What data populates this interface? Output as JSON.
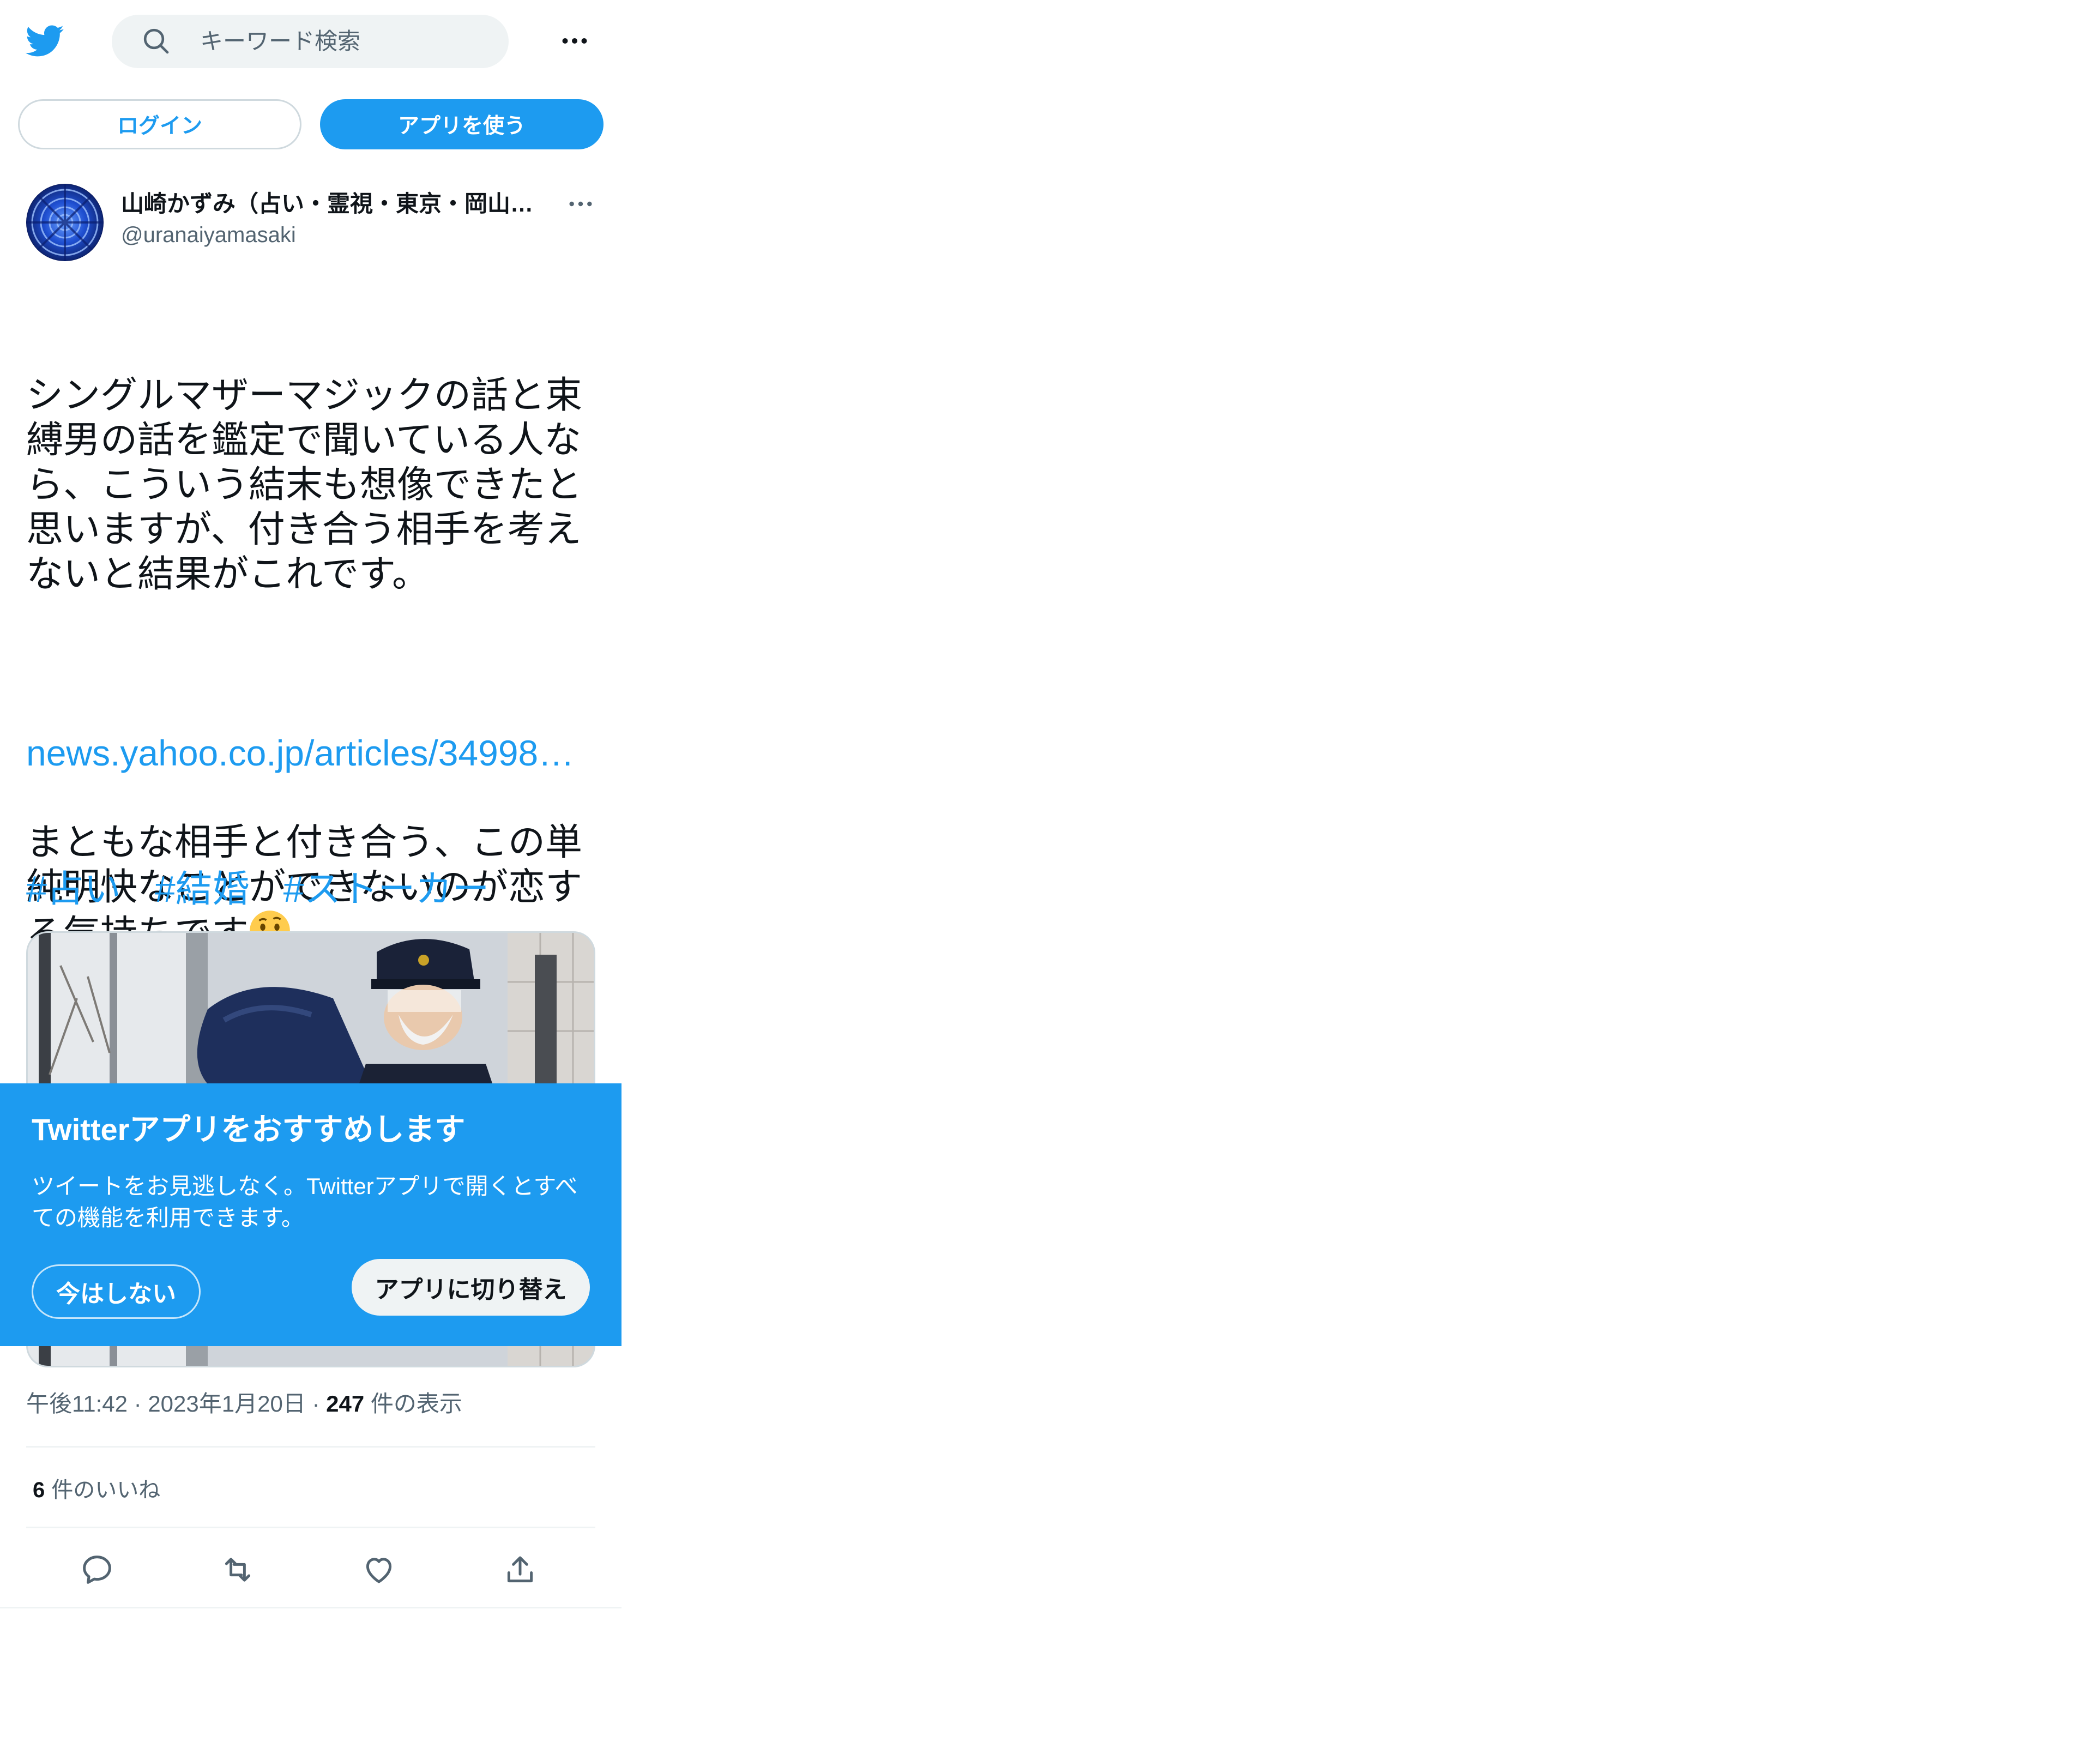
{
  "header": {
    "search_placeholder": "キーワード検索"
  },
  "auth": {
    "login_label": "ログイン",
    "use_app_label": "アプリを使う"
  },
  "tweet": {
    "author_name": "山崎かずみ（占い・霊視・東京・岡山・大阪）",
    "author_handle": "@uranaiyamasaki",
    "text_p1": "シングルマザーマジックの話と束縛男の話を鑑定で聞いている人なら、こういう結末も想像できたと思いますが、付き合う相手を考えないと結果がこれです。",
    "text_p2": "まともな相手と付き合う、この単純明快なことができないのが恋する気持ちです",
    "emoji": "thinking-face",
    "link": "news.yahoo.co.jp/articles/34998…",
    "hashtags": [
      "#占い",
      "#結婚",
      "#ストーカー"
    ],
    "time": "午後11:42",
    "date": "2023年1月20日",
    "views_count": "247",
    "views_label": "件の表示",
    "likes_count": "6",
    "likes_label": "件のいいね"
  },
  "banner": {
    "title": "Twitterアプリをおすすめします",
    "description": "ツイートをお見逃しなく。Twitterアプリで開くとすべての機能を利用できます。",
    "not_now_label": "今はしない",
    "switch_label": "アプリに切り替え"
  },
  "colors": {
    "brand_blue": "#1d9bf0",
    "text_primary": "#0f1419",
    "text_secondary": "#536471",
    "border": "#cfd9de"
  }
}
